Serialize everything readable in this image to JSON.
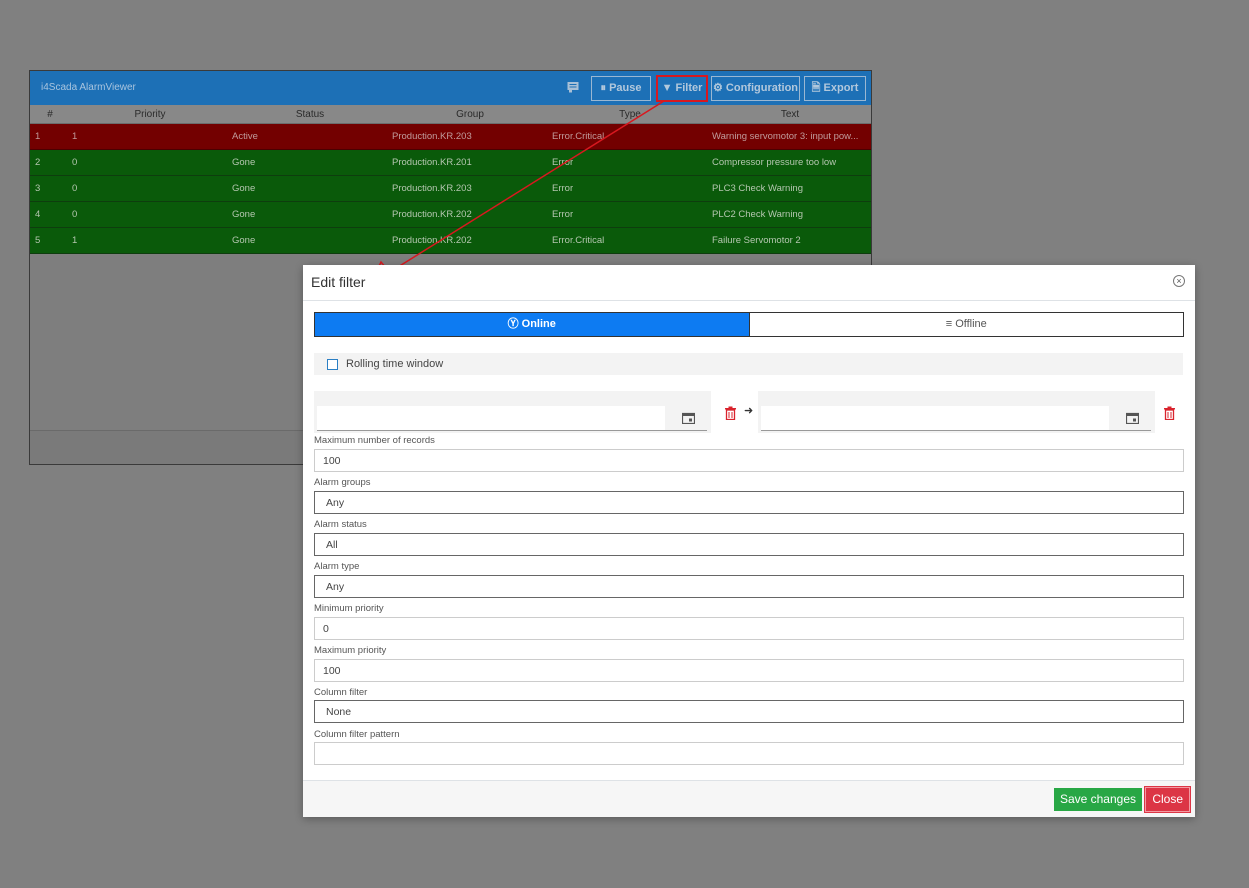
{
  "viewer": {
    "title": "i4Scada AlarmViewer",
    "toolbar": {
      "pause_label": "Pause",
      "filter_label": "Filter",
      "configuration_label": "Configuration",
      "export_label": "Export"
    },
    "columns": [
      "#",
      "Priority",
      "Status",
      "Group",
      "Type",
      "Text"
    ],
    "rows": [
      {
        "num": "1",
        "priority": "1",
        "status": "Active",
        "group": "Production.KR.203",
        "type": "Error.Critical",
        "text": "Warning servomotor 3: input pow..."
      },
      {
        "num": "2",
        "priority": "0",
        "status": "Gone",
        "group": "Production.KR.201",
        "type": "Error",
        "text": "Compressor pressure too low"
      },
      {
        "num": "3",
        "priority": "0",
        "status": "Gone",
        "group": "Production.KR.203",
        "type": "Error",
        "text": "PLC3 Check Warning"
      },
      {
        "num": "4",
        "priority": "0",
        "status": "Gone",
        "group": "Production.KR.202",
        "type": "Error",
        "text": "PLC2 Check Warning"
      },
      {
        "num": "5",
        "priority": "1",
        "status": "Gone",
        "group": "Production.KR.202",
        "type": "Error.Critical",
        "text": "Failure Servomotor 2"
      }
    ]
  },
  "modal": {
    "title": "Edit filter",
    "tabs": {
      "online": "Online",
      "offline": "Offline"
    },
    "rolling_label": "Rolling time window",
    "fields": {
      "max_records": {
        "label": "Maximum number of records",
        "value": "100"
      },
      "alarm_groups": {
        "label": "Alarm groups",
        "value": "Any"
      },
      "alarm_status": {
        "label": "Alarm status",
        "value": "All"
      },
      "alarm_type": {
        "label": "Alarm type",
        "value": "Any"
      },
      "min_priority": {
        "label": "Minimum priority",
        "value": "0"
      },
      "max_priority": {
        "label": "Maximum priority",
        "value": "100"
      },
      "column_filter": {
        "label": "Column filter",
        "value": "None"
      },
      "column_filter_pattern": {
        "label": "Column filter pattern",
        "value": ""
      }
    },
    "save_label": "Save changes",
    "close_label": "Close",
    "close_x": "×"
  },
  "colors": {
    "header_blue": "#1d70b6",
    "active_red": "#730000",
    "gone_green": "#0a5a0a",
    "online_blue": "#0d7bf2",
    "save_green": "#28a745",
    "close_red": "#dc3545",
    "trash_red": "#d9232d",
    "annotation_red": "#d8181f"
  }
}
